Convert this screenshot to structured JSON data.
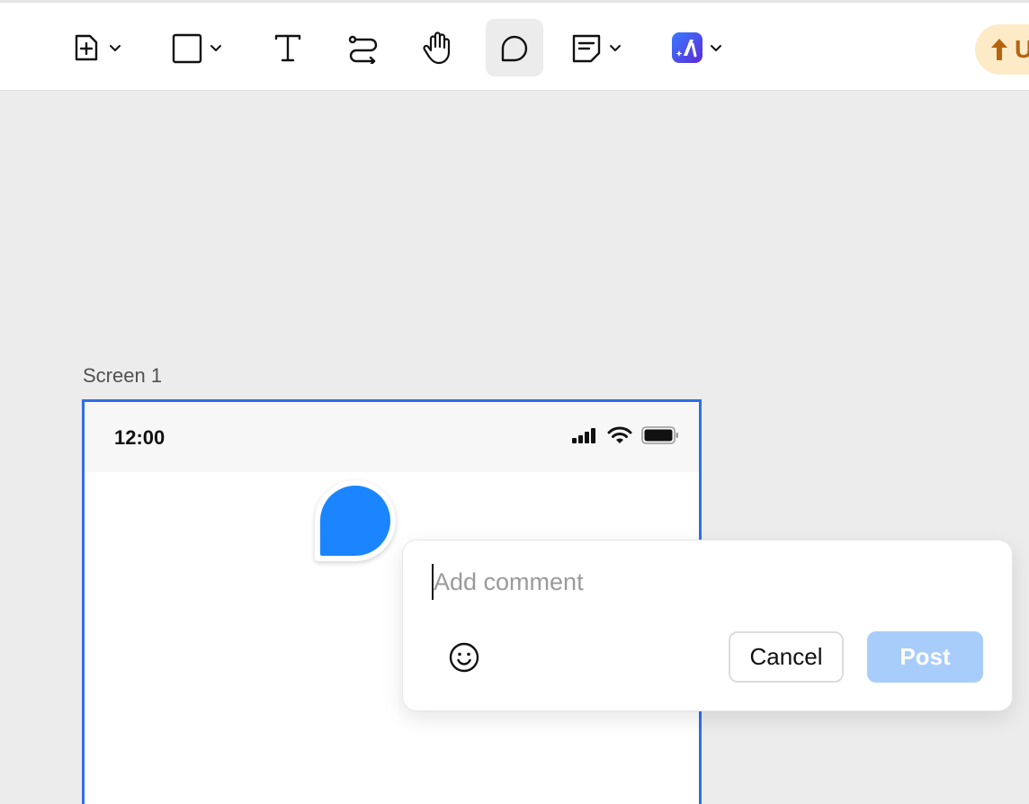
{
  "toolbar": {
    "tools": [
      {
        "name": "insert-frame-tool",
        "icon": "plus-square-icon",
        "has_dropdown": true
      },
      {
        "name": "shape-tool",
        "icon": "square-icon",
        "has_dropdown": true
      },
      {
        "name": "text-tool",
        "icon": "text-T-icon",
        "has_dropdown": false
      },
      {
        "name": "connector-tool",
        "icon": "connector-icon",
        "has_dropdown": false
      },
      {
        "name": "hand-tool",
        "icon": "hand-icon",
        "has_dropdown": false
      },
      {
        "name": "comment-tool",
        "icon": "speech-bubble-icon",
        "has_dropdown": false,
        "active": true
      },
      {
        "name": "sticky-note-tool",
        "icon": "note-icon",
        "has_dropdown": true
      },
      {
        "name": "ai-tool",
        "icon": "ai-app-icon",
        "has_dropdown": true
      }
    ],
    "upgrade_label": "U"
  },
  "canvas": {
    "frame_label": "Screen 1",
    "status_bar": {
      "time": "12:00",
      "icons": [
        "signal-icon",
        "wifi-icon",
        "battery-icon"
      ]
    }
  },
  "comment": {
    "placeholder": "Add comment",
    "value": "",
    "cancel_label": "Cancel",
    "post_label": "Post"
  },
  "colors": {
    "accent": "#2f6fe4",
    "pin": "#1a85ff",
    "post_disabled": "#a8cdfb",
    "upgrade_bg": "#fdebc8",
    "upgrade_fg": "#b5650d"
  }
}
